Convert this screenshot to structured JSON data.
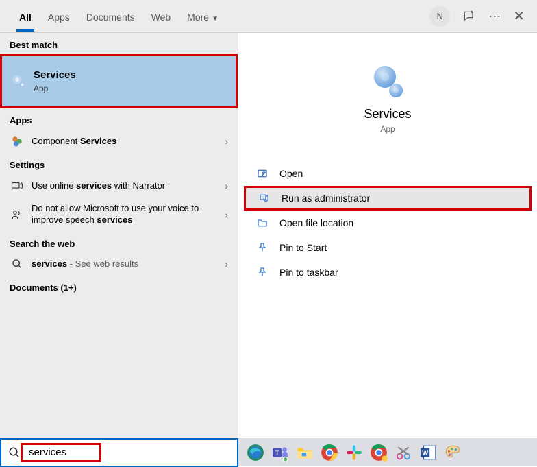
{
  "tabs": {
    "all": "All",
    "apps": "Apps",
    "documents": "Documents",
    "web": "Web",
    "more": "More"
  },
  "user_initial": "N",
  "left": {
    "best_match_label": "Best match",
    "best_match": {
      "title": "Services",
      "sub": "App"
    },
    "apps_label": "Apps",
    "apps_item_pre": "Component ",
    "apps_item_bold": "Services",
    "settings_label": "Settings",
    "setting1_pre": "Use online ",
    "setting1_bold": "services",
    "setting1_post": " with Narrator",
    "setting2_pre": "Do not allow Microsoft to use your voice to improve speech ",
    "setting2_bold": "services",
    "web_label": "Search the web",
    "web_item_bold": "services",
    "web_item_post": " - See web results",
    "documents_label": "Documents (1+)"
  },
  "preview": {
    "title": "Services",
    "sub": "App",
    "actions": {
      "open": "Open",
      "run_admin": "Run as administrator",
      "open_loc": "Open file location",
      "pin_start": "Pin to Start",
      "pin_taskbar": "Pin to taskbar"
    }
  },
  "search_value": "services"
}
